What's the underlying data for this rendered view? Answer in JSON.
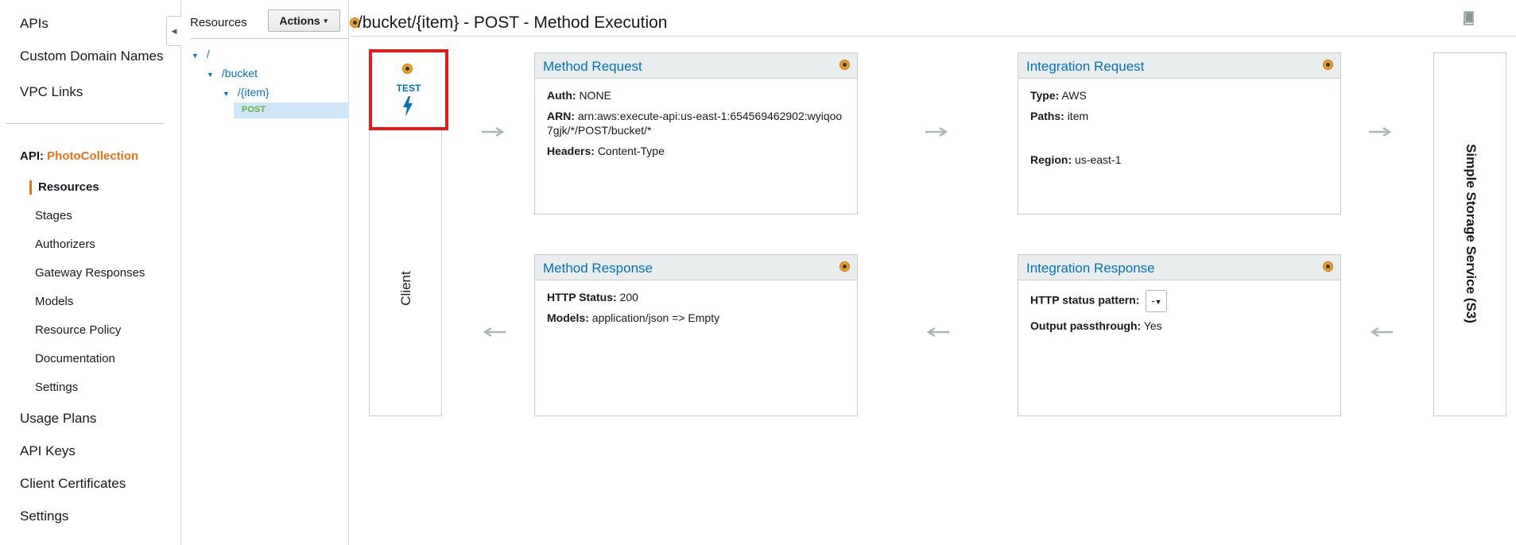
{
  "nav": {
    "top_items": [
      "APIs",
      "Custom Domain Names",
      "VPC Links"
    ],
    "api_prefix": "API:",
    "api_name": "PhotoCollection",
    "sub_items": [
      "Resources",
      "Stages",
      "Authorizers",
      "Gateway Responses",
      "Models",
      "Resource Policy",
      "Documentation",
      "Settings"
    ],
    "bottom_items": [
      "Usage Plans",
      "API Keys",
      "Client Certificates",
      "Settings"
    ]
  },
  "resources": {
    "title": "Resources",
    "actions_label": "Actions",
    "tree": [
      "/",
      "/bucket",
      "/{item}"
    ],
    "selected_method": "POST"
  },
  "page": {
    "title": "/bucket/{item} - POST - Method Execution"
  },
  "client": {
    "label": "Client",
    "test_label": "TEST"
  },
  "method_request": {
    "title": "Method Request",
    "auth_label": "Auth:",
    "auth_value": "NONE",
    "arn_label": "ARN:",
    "arn_value": "arn:aws:execute-api:us-east-1:654569462902:wyiqoo7gjk/*/POST/bucket/*",
    "headers_label": "Headers:",
    "headers_value": "Content-Type"
  },
  "integration_request": {
    "title": "Integration Request",
    "type_label": "Type:",
    "type_value": "AWS",
    "paths_label": "Paths:",
    "paths_value": "item",
    "region_label": "Region:",
    "region_value": "us-east-1"
  },
  "method_response": {
    "title": "Method Response",
    "status_label": "HTTP Status:",
    "status_value": "200",
    "models_label": "Models:",
    "models_value": "application/json => Empty"
  },
  "integration_response": {
    "title": "Integration Response",
    "pattern_label": "HTTP status pattern:",
    "pattern_value": "-",
    "passthrough_label": "Output passthrough:",
    "passthrough_value": "Yes"
  },
  "backend": {
    "label": "Simple Storage Service (S3)"
  },
  "colors": {
    "link_blue": "#0073bb",
    "accent_orange": "#ec7211",
    "post_green": "#6aaf35",
    "test_border_red": "#e31b1b"
  }
}
